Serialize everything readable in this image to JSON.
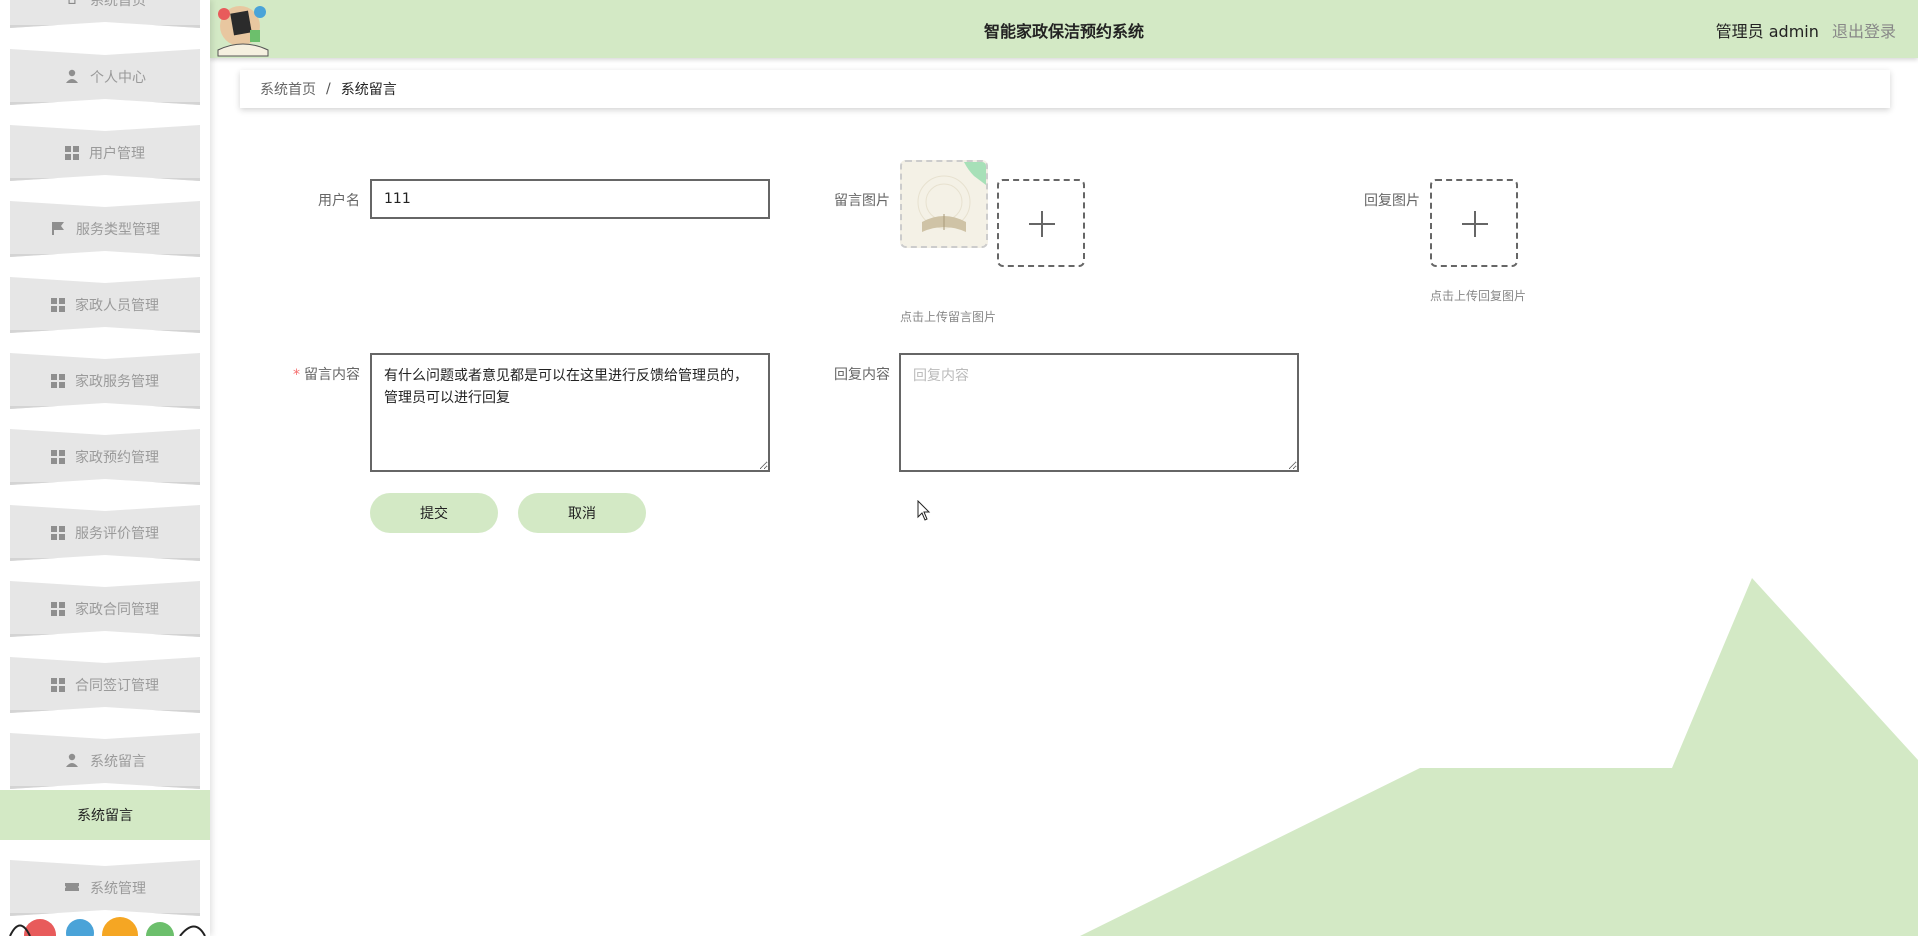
{
  "header": {
    "title": "智能家政保洁预约系统",
    "user_role": "管理员",
    "username": "admin",
    "logout_label": "退出登录"
  },
  "sidebar": {
    "items": [
      {
        "label": "系统首页",
        "icon": "home-icon"
      },
      {
        "label": "个人中心",
        "icon": "user-icon"
      },
      {
        "label": "用户管理",
        "icon": "grid-icon"
      },
      {
        "label": "服务类型管理",
        "icon": "flag-icon"
      },
      {
        "label": "家政人员管理",
        "icon": "grid-icon"
      },
      {
        "label": "家政服务管理",
        "icon": "grid-icon"
      },
      {
        "label": "家政预约管理",
        "icon": "grid-icon"
      },
      {
        "label": "服务评价管理",
        "icon": "grid-icon"
      },
      {
        "label": "家政合同管理",
        "icon": "grid-icon"
      },
      {
        "label": "合同签订管理",
        "icon": "grid-icon"
      },
      {
        "label": "系统留言",
        "icon": "user-icon"
      }
    ],
    "active_subitem": "系统留言",
    "last_item": {
      "label": "系统管理",
      "icon": "ticket-icon"
    }
  },
  "breadcrumb": {
    "home": "系统首页",
    "separator": "/",
    "current": "系统留言"
  },
  "form": {
    "username_label": "用户名",
    "username_value": "111",
    "message_image_label": "留言图片",
    "message_image_hint": "点击上传留言图片",
    "reply_image_label": "回复图片",
    "reply_image_hint": "点击上传回复图片",
    "message_content_label": "留言内容",
    "message_content_required_mark": "*",
    "message_content_value": "有什么问题或者意见都是可以在这里进行反馈给管理员的，管理员可以进行回复",
    "reply_content_label": "回复内容",
    "reply_content_placeholder": "回复内容",
    "submit_label": "提交",
    "cancel_label": "取消"
  },
  "colors": {
    "accent": "#d3e9c5",
    "menu_bg": "#e6e6e6",
    "required": "#f56c6c"
  }
}
